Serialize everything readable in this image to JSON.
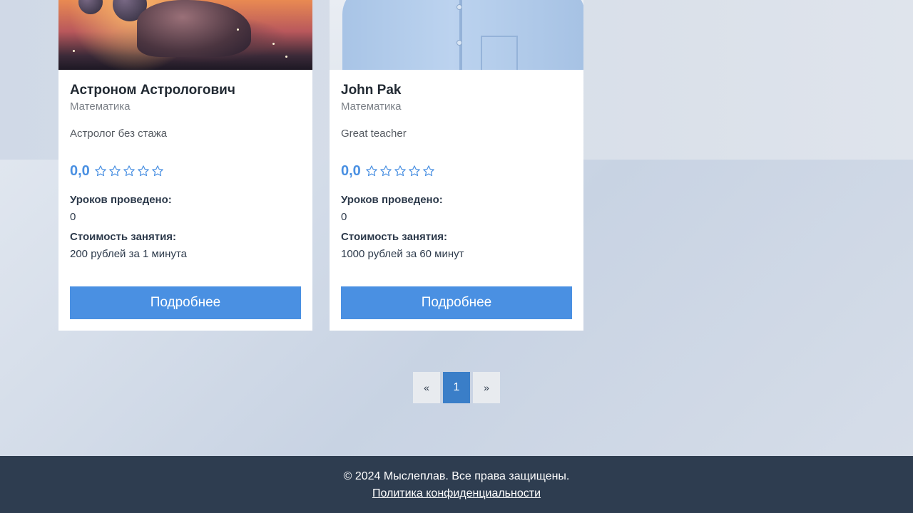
{
  "tutors": [
    {
      "name": "Астроном Астрологович",
      "subject": "Математика",
      "description": "Астролог без стажа",
      "rating": "0,0",
      "stars_filled": 0,
      "stars_total": 5,
      "lessons_label": "Уроков проведено:",
      "lessons_value": "0",
      "price_label": "Стоимость занятия:",
      "price_value": "200 рублей за 1 минута",
      "details_label": "Подробнее"
    },
    {
      "name": "John Pak",
      "subject": "Математика",
      "description": "Great teacher",
      "rating": "0,0",
      "stars_filled": 0,
      "stars_total": 5,
      "lessons_label": "Уроков проведено:",
      "lessons_value": "0",
      "price_label": "Стоимость занятия:",
      "price_value": "1000 рублей за 60 минут",
      "details_label": "Подробнее"
    }
  ],
  "pagination": {
    "prev": "«",
    "current": "1",
    "next": "»"
  },
  "footer": {
    "copyright": "© 2024 Мыслеплав. Все права защищены.",
    "privacy_link": "Политика конфиденциальности"
  },
  "colors": {
    "accent": "#4a90e2",
    "pagination_active": "#3a7ec8",
    "footer_bg": "#2e3d50"
  },
  "icons": {
    "rating_star": "star-outline-icon"
  }
}
